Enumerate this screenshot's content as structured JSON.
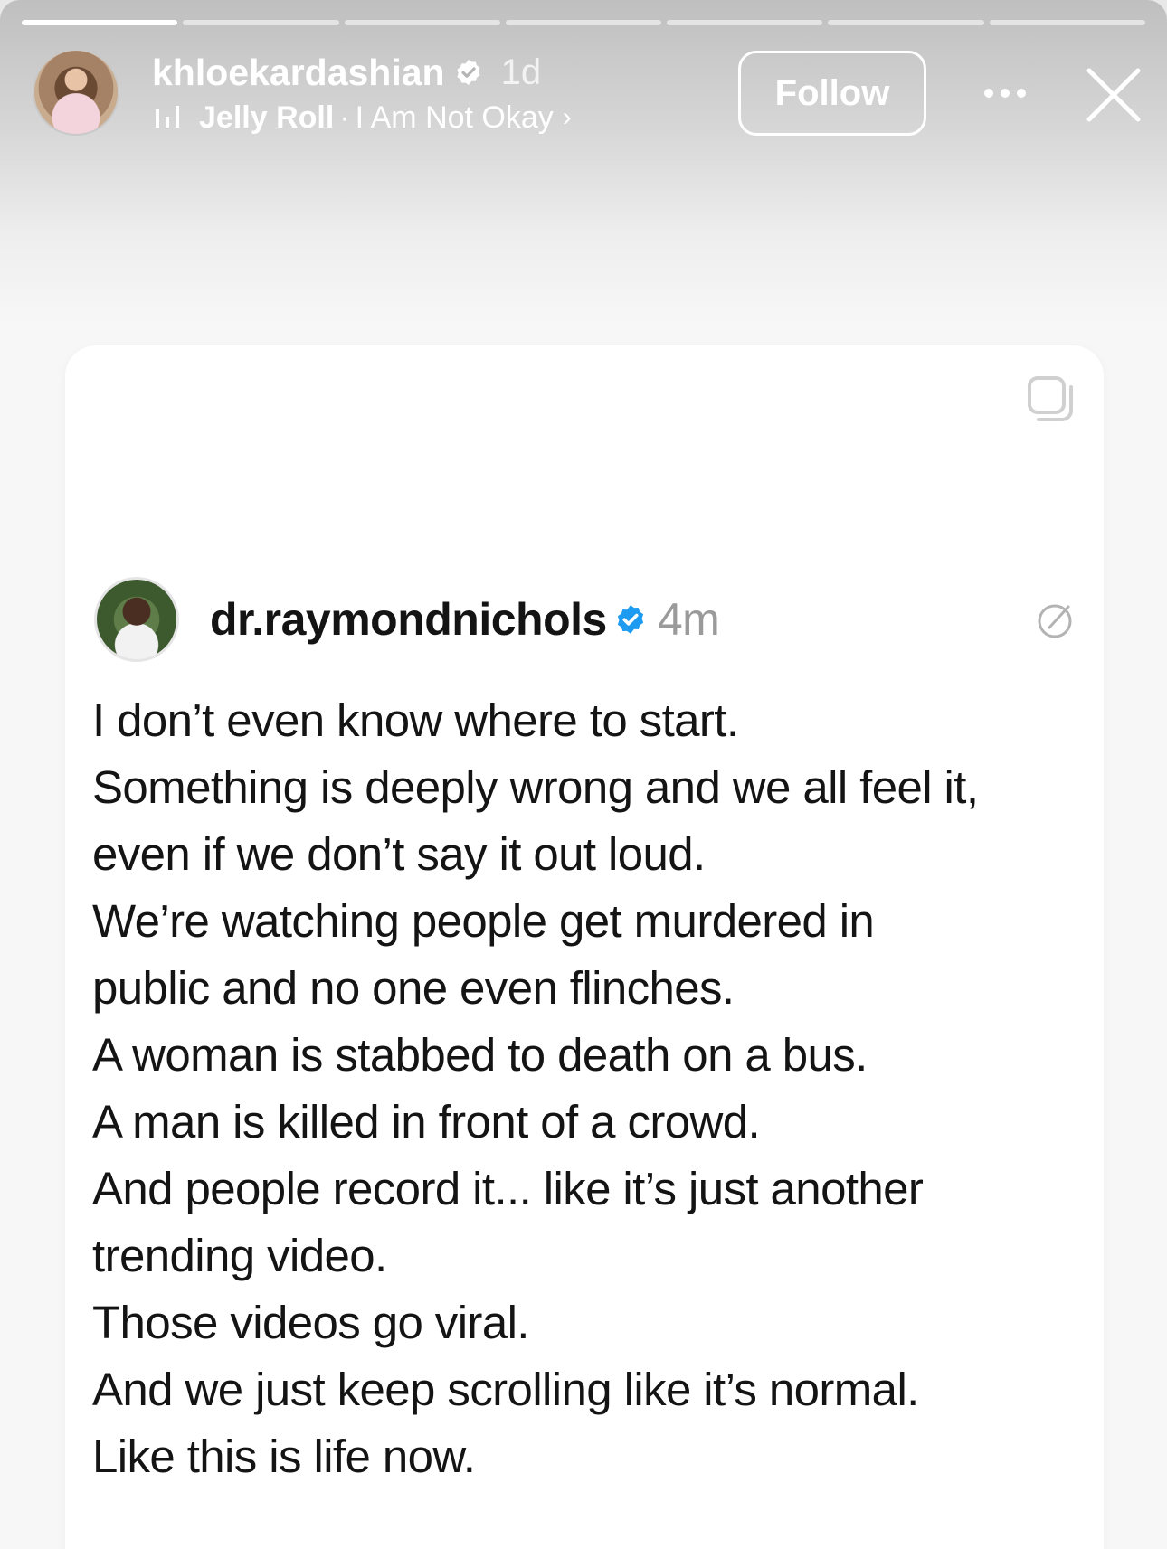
{
  "story": {
    "progress": {
      "segments": 7,
      "active_index": 0,
      "active_fraction": 1.0
    },
    "header": {
      "username": "khloekardashian",
      "verified": true,
      "time": "1d",
      "music": {
        "artist": "Jelly Roll",
        "separator": "·",
        "song": "I Am Not Okay",
        "chevron": "›"
      },
      "follow_label": "Follow",
      "more_icon": "more-horizontal-icon",
      "close_icon": "close-icon"
    }
  },
  "post": {
    "author": "dr.raymondnichols",
    "verified": true,
    "time": "4m",
    "lines": [
      "I don’t even know where to start.",
      "Something is deeply wrong and we all feel it,",
      "even if we don’t say it out loud.",
      "We’re watching people get murdered in",
      "public and no one even flinches.",
      "A woman is stabbed to death on a bus.",
      "A man is killed in front of a crowd.",
      "And people record it... like it’s just another",
      "trending video.",
      "Those videos go viral.",
      "And we just keep scrolling like it’s normal.",
      "Like this is life now."
    ]
  },
  "colors": {
    "verified_blue": "#1d9bf0",
    "text": "#141414",
    "muted": "#9a9a9a"
  }
}
